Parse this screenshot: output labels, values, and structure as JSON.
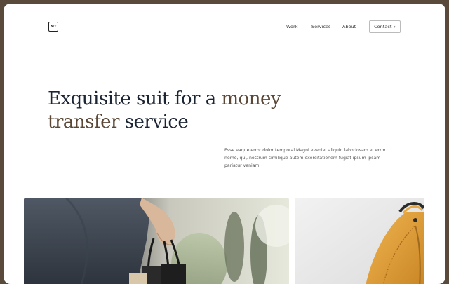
{
  "header": {
    "logo_text": "ALT",
    "nav": {
      "work": "Work",
      "services": "Services",
      "about": "About",
      "contact": "Contact"
    }
  },
  "hero": {
    "title_line1_plain": "Exquisite suit for a ",
    "title_line1_accent": "money",
    "title_line2_accent": "transfer",
    "title_line2_plain": " service",
    "description": "Esse eaque error dolor temporal Magni eveniet aliquid laboriosam et error nemo, qui, nostrum similique autem exercitationem fugiat ipsum ipsam pariatur veniam."
  },
  "colors": {
    "frame_border": "#5a4a3c",
    "title": "#1b2433",
    "accent": "#5a4736",
    "bag_orange": "#e8a640"
  },
  "icons": {
    "contact_arrow": "chevron-right-icon"
  }
}
